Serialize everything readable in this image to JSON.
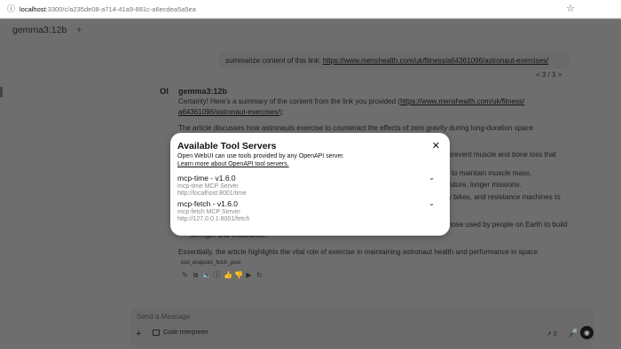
{
  "browser": {
    "url_host": "localhost",
    "url_path": ":3300/c/a235de08-a714-41a9-881c-a6ecdea5a5ea"
  },
  "header": {
    "model": "gemma3:12b",
    "add": "+"
  },
  "user_message": {
    "prefix": "summarize content of this link: ",
    "link": "https://www.menshealth.com/uk/fitness/a64361096/astronaut-exercises/",
    "pager": "< 3 / 3 >"
  },
  "assistant": {
    "avatar": "Ol",
    "name": "gemma3:12b",
    "intro_prefix": "Certainly! Here's a summary of the content from the link you provided (",
    "intro_link_1": "https://www.menshealth.com/uk/fitness/",
    "intro_link_2": "a64361096/astronaut-exercises/",
    "intro_suffix": "):",
    "para1": "The article discusses how astronauts exercise to counteract the effects of zero gravity during long-duration space",
    "frag_prevent": "prevent muscle and bone loss that",
    "frag_maintain": "l to maintain muscle mass.",
    "frag_future": "future, longer missions.",
    "frag_bikes": "y bikes, and resistance machines to",
    "frag_earth": "hose used by people on Earth to build",
    "frag_strength": "strength and endurance.",
    "closing": "Essentially, the article highlights the vital role of exercise in maintaining astronaut health and performance in space.",
    "tool_chip": "tool_endpoint_fetch_post"
  },
  "composer": {
    "placeholder": "Send a Message",
    "code_interpreter": "Code Interpreter",
    "tools_count": "2"
  },
  "modal": {
    "title": "Available Tool Servers",
    "description": "Open WebUI can use tools provided by any OpenAPI server.",
    "learn_more": "Learn more about OpenAPI tool servers.",
    "servers": [
      {
        "name": "mcp-time - v1.6.0",
        "kind": "mcp-time MCP Server",
        "url": "http://localhost:8001/time"
      },
      {
        "name": "mcp-fetch - v1.6.0",
        "kind": "mcp-fetch MCP Server",
        "url": "http://127.0.0.1:8001/fetch"
      }
    ]
  }
}
